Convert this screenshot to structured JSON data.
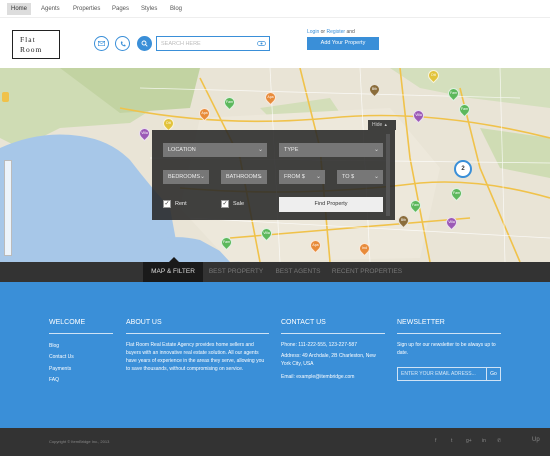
{
  "nav": {
    "items": [
      "Home",
      "Agents",
      "Properties",
      "Pages",
      "Styles",
      "Blog"
    ]
  },
  "header": {
    "logo_line1": "Flat",
    "logo_line2": "Room",
    "search_placeholder": "Search here",
    "login": "Login",
    "or": "or",
    "register": "Register",
    "and": "and",
    "add_property": "Add Your Property"
  },
  "map": {
    "cluster_count": "2",
    "pin_labels": [
      "Apa",
      "Dtt",
      "Bth",
      "Fam",
      "Apa",
      "Villa",
      "Apa",
      "Fam",
      "Ind",
      "Villa",
      "Fam",
      "Apa",
      "Bth",
      "Villa",
      "Bth",
      "Fam",
      "Fam",
      "Fam",
      "Villa",
      "Ind",
      "Dtt"
    ],
    "pin_colors": {
      "Fam": "#5cb85c",
      "Apa": "#e88b3a",
      "Villa": "#9b59b6",
      "Dtt": "#e2c33b",
      "Bth": "#8b6d3b",
      "Ind": "#c47a3a"
    }
  },
  "filter": {
    "hide_label": "Hide",
    "location": "Location",
    "type": "Type",
    "bedrooms": "Bedrooms",
    "bathrooms": "Bathrooms",
    "from": "From $",
    "to": "To $",
    "rent_label": "Rent",
    "sale_label": "Sale",
    "find_button": "Find Property"
  },
  "tabs": [
    "Map & filter",
    "Best Property",
    "Best Agents",
    "Recent Properties"
  ],
  "footer": {
    "welcome_title": "Welcome",
    "welcome_links": [
      "Blog",
      "Contact Us",
      "Payments",
      "FAQ"
    ],
    "about_title": "About Us",
    "about_text": "Flat Room Real Estate Agency provides home sellers and buyers with an innovative real estate solution. All our agents have years of experience in the areas they serve, allowing you to save thousands, without compromising on service.",
    "contact_title": "Contact Us",
    "phone": "Phone: 111-222-555, 123-227-587",
    "address": "Address: 49 Archdale, 2B Charleston, New York City, USA",
    "email": "Email: example@itembridge.com",
    "newsletter_title": "Newsletter",
    "newsletter_text": "Sign up for our newsletter to be always up to date.",
    "email_placeholder": "Enter your email adress...",
    "go": "Go"
  },
  "bottom": {
    "copyright": "Copyright © ItemBridge Inc., 2013",
    "social": [
      "f",
      "t",
      "g+",
      "in",
      "&#9990;"
    ],
    "up": "Up"
  },
  "colors": {
    "accent": "#3a8fd8",
    "dark": "#333333"
  }
}
